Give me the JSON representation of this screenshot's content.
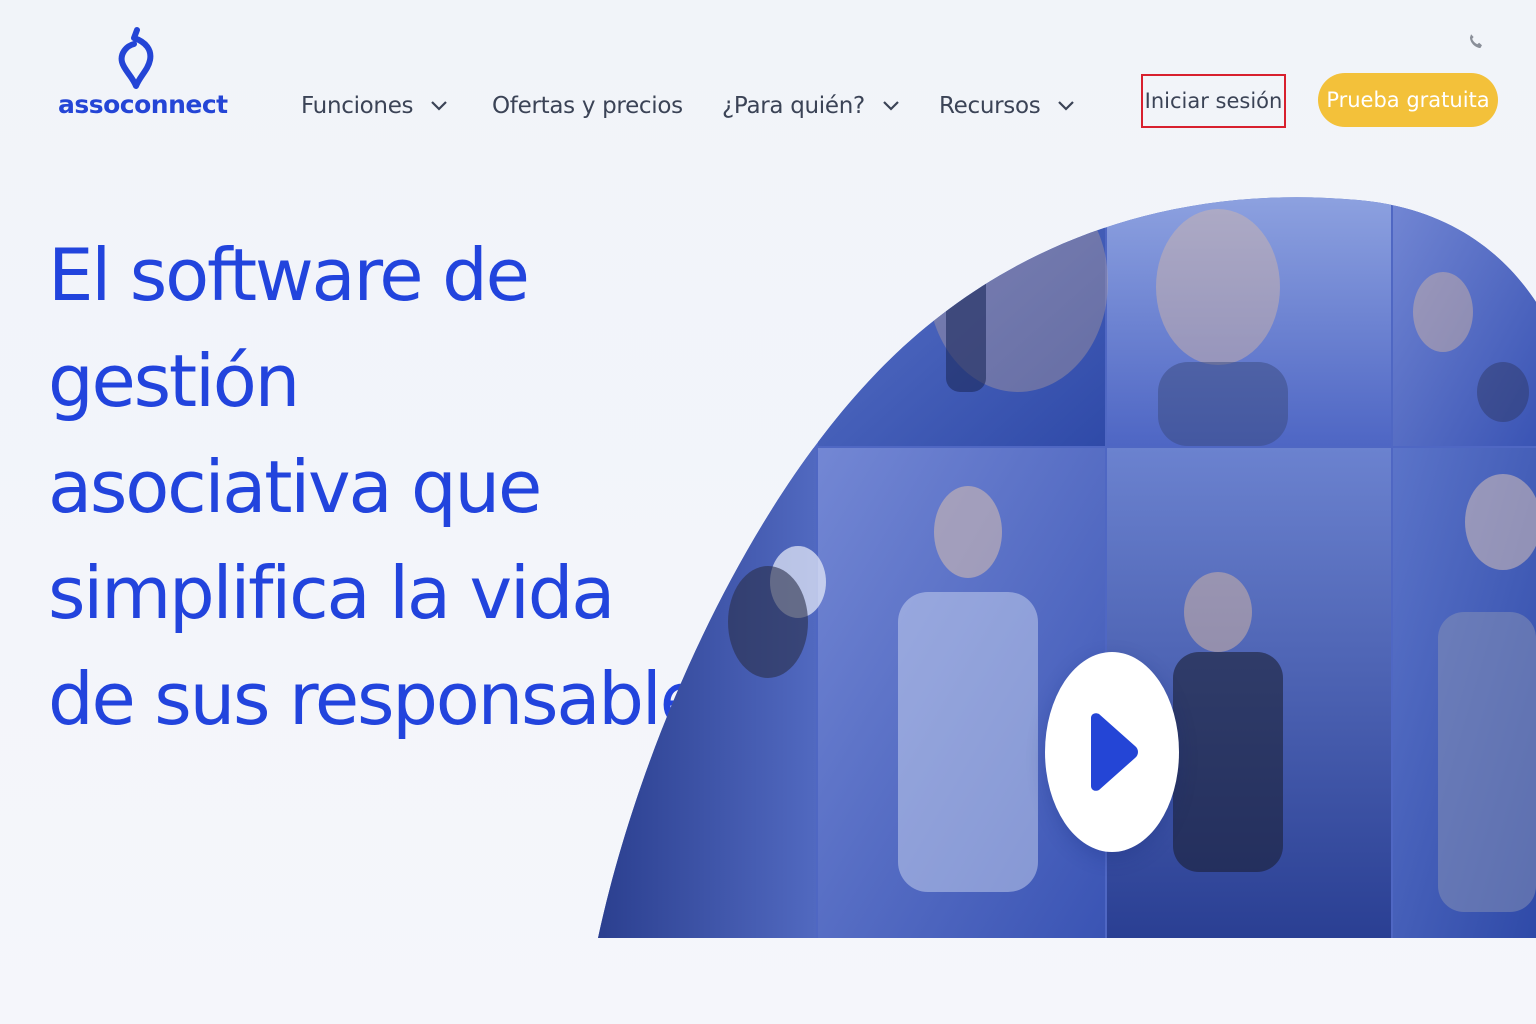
{
  "brand": {
    "name": "assoconnect",
    "primary_color": "#2445d6",
    "accent_color": "#f3c13a"
  },
  "nav": {
    "items": [
      {
        "label": "Funciones",
        "has_dropdown": true
      },
      {
        "label": "Ofertas y precios",
        "has_dropdown": false
      },
      {
        "label": "¿Para quién?",
        "has_dropdown": true
      },
      {
        "label": "Recursos",
        "has_dropdown": true
      }
    ]
  },
  "header": {
    "phone_icon": "phone-icon",
    "login_label": "Iniciar sesión",
    "trial_label": "Prueba gratuita"
  },
  "hero": {
    "title_lines": [
      "El software de",
      "gestión",
      "asociativa que",
      "simplifica la vida",
      "de sus responsables"
    ],
    "media_icon": "play-icon"
  }
}
